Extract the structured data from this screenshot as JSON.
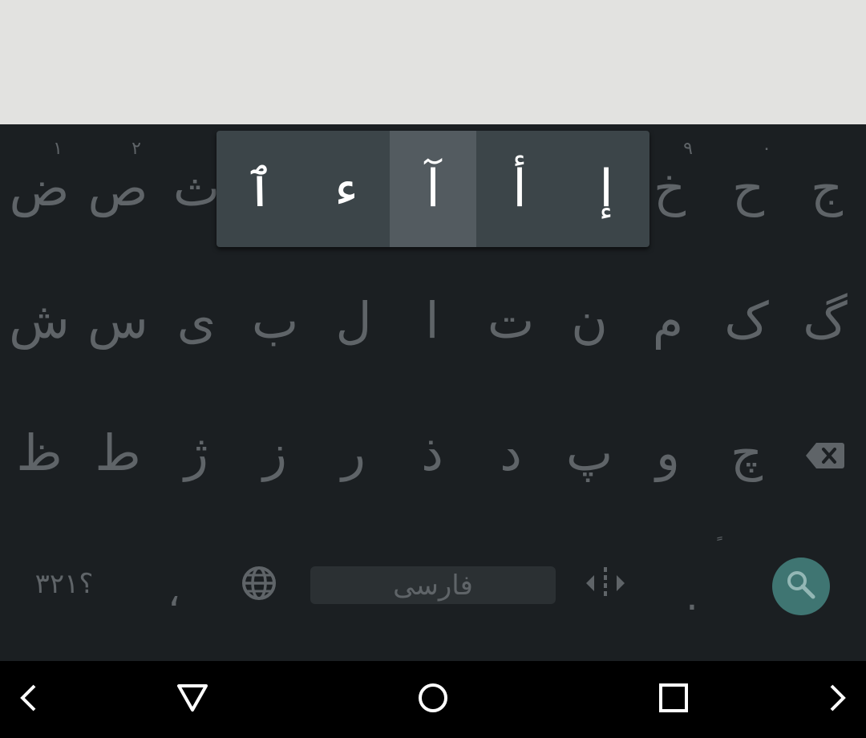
{
  "colors": {
    "app_background": "#e2e2e0",
    "keyboard_background": "#1b1f22",
    "key_text": "#5f6468",
    "popup_background": "#3c4549",
    "popup_selected": "#535b60",
    "search_accent": "#3f7572",
    "navbar_background": "#000000"
  },
  "keyboard": {
    "row1": [
      {
        "label": "ض",
        "hint": "۱"
      },
      {
        "label": "ص",
        "hint": "۲"
      },
      {
        "label": "ث",
        "hint": ""
      },
      {
        "label": "خ",
        "hint": "۹"
      },
      {
        "label": "ح",
        "hint": "۰"
      },
      {
        "label": "ج",
        "hint": ""
      }
    ],
    "row2": [
      "ش",
      "س",
      "ی",
      "ب",
      "ل",
      "ا",
      "ت",
      "ن",
      "م",
      "ک",
      "گ"
    ],
    "row3": [
      "ظ",
      "ط",
      "ژ",
      "ز",
      "ر",
      "ذ",
      "د",
      "پ",
      "و",
      "چ"
    ],
    "row4": {
      "symbols_label": "؟۳۲۱",
      "comma_label": "،",
      "space_label": "فارسی",
      "period_label": ".",
      "period_hint": "ً",
      "language_icon": "globe-icon",
      "cursor_icon": "cursor-move-icon",
      "search_icon": "search-icon",
      "delete_icon": "backspace-icon"
    },
    "popup": {
      "alternates": [
        "ٱ",
        "ء",
        "آ",
        "أ",
        "إ"
      ],
      "selected": "آ"
    }
  },
  "navbar": {
    "icons": [
      "chevron-left-icon",
      "back-triangle-icon",
      "home-circle-icon",
      "recents-square-icon",
      "chevron-right-icon"
    ]
  }
}
